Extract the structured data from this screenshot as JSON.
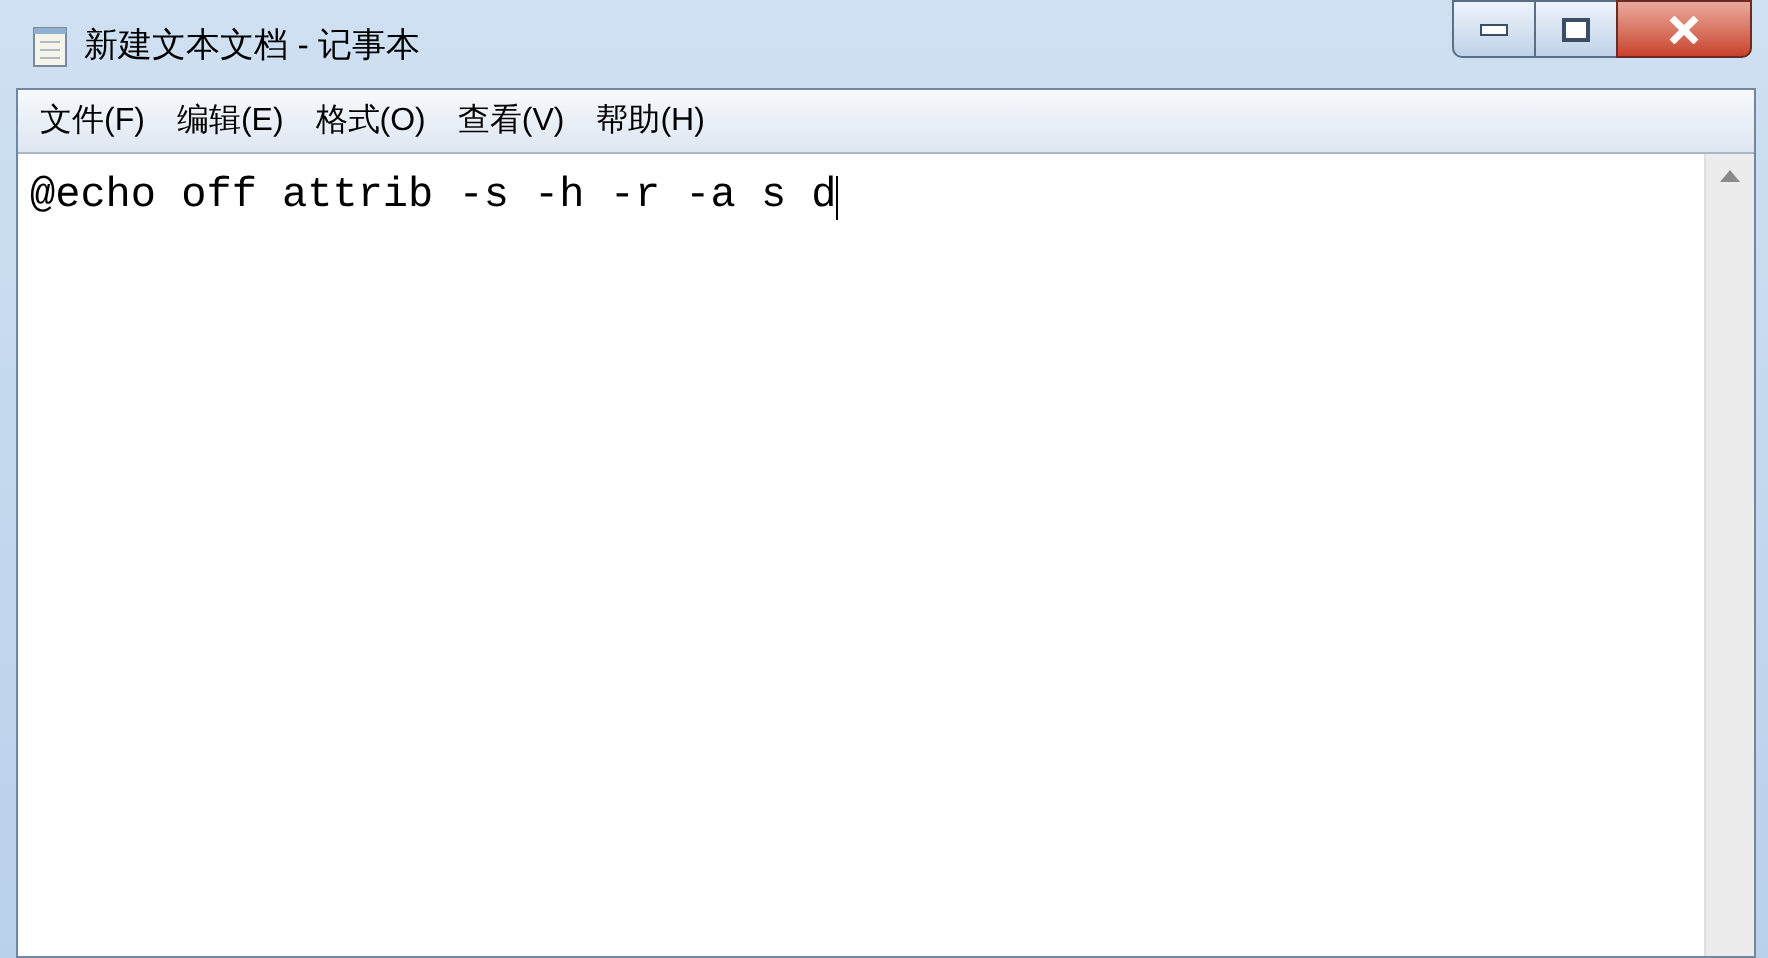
{
  "window": {
    "title": "新建文本文档 - 记事本"
  },
  "menu": [
    {
      "label": "文件(F)"
    },
    {
      "label": "编辑(E)"
    },
    {
      "label": "格式(O)"
    },
    {
      "label": "查看(V)"
    },
    {
      "label": "帮助(H)"
    }
  ],
  "editor": {
    "text": "@echo off attrib -s -h -r -a s d"
  }
}
